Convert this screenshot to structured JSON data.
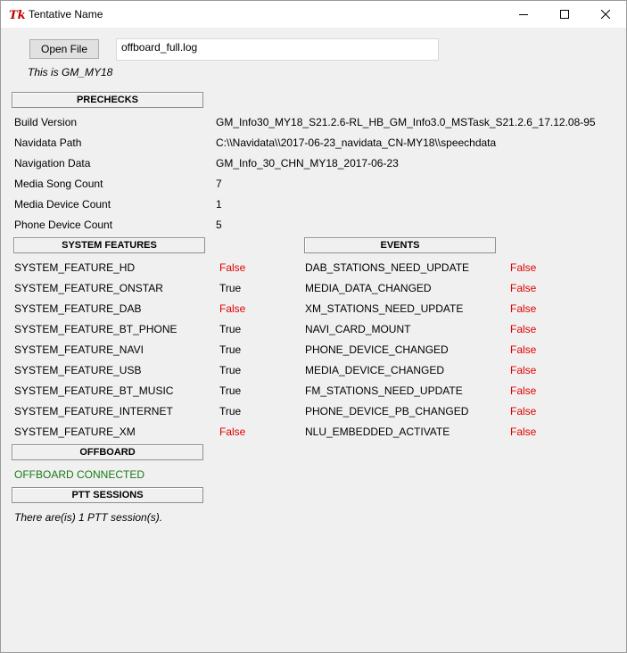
{
  "window": {
    "title": "Tentative Name"
  },
  "file": {
    "open_button": "Open File",
    "path_value": "offboard_full.log",
    "info": "This is GM_MY18"
  },
  "prechecks": {
    "header": "PRECHECKS",
    "rows": [
      {
        "label": "Build Version",
        "value": "GM_Info30_MY18_S21.2.6-RL_HB_GM_Info3.0_MSTask_S21.2.6_17.12.08-95"
      },
      {
        "label": "Navidata Path",
        "value": "C:\\\\Navidata\\\\2017-06-23_navidata_CN-MY18\\\\speechdata"
      },
      {
        "label": "Navigation Data",
        "value": "GM_Info_30_CHN_MY18_2017-06-23"
      },
      {
        "label": "Media Song Count",
        "value": "7"
      },
      {
        "label": "Media Device Count",
        "value": "1"
      },
      {
        "label": "Phone Device Count",
        "value": "5"
      }
    ]
  },
  "system_features": {
    "header": "SYSTEM FEATURES",
    "rows": [
      {
        "label": "SYSTEM_FEATURE_HD",
        "value": "False"
      },
      {
        "label": "SYSTEM_FEATURE_ONSTAR",
        "value": "True"
      },
      {
        "label": "SYSTEM_FEATURE_DAB",
        "value": "False"
      },
      {
        "label": "SYSTEM_FEATURE_BT_PHONE",
        "value": "True"
      },
      {
        "label": "SYSTEM_FEATURE_NAVI",
        "value": "True"
      },
      {
        "label": "SYSTEM_FEATURE_USB",
        "value": "True"
      },
      {
        "label": "SYSTEM_FEATURE_BT_MUSIC",
        "value": "True"
      },
      {
        "label": "SYSTEM_FEATURE_INTERNET",
        "value": "True"
      },
      {
        "label": "SYSTEM_FEATURE_XM",
        "value": "False"
      }
    ]
  },
  "events": {
    "header": "EVENTS",
    "rows": [
      {
        "label": "DAB_STATIONS_NEED_UPDATE",
        "value": "False"
      },
      {
        "label": "MEDIA_DATA_CHANGED",
        "value": "False"
      },
      {
        "label": "XM_STATIONS_NEED_UPDATE",
        "value": "False"
      },
      {
        "label": "NAVI_CARD_MOUNT",
        "value": "False"
      },
      {
        "label": "PHONE_DEVICE_CHANGED",
        "value": "False"
      },
      {
        "label": "MEDIA_DEVICE_CHANGED",
        "value": "False"
      },
      {
        "label": "FM_STATIONS_NEED_UPDATE",
        "value": "False"
      },
      {
        "label": "PHONE_DEVICE_PB_CHANGED",
        "value": "False"
      },
      {
        "label": "NLU_EMBEDDED_ACTIVATE",
        "value": "False"
      }
    ]
  },
  "offboard": {
    "header": "OFFBOARD",
    "status": "OFFBOARD CONNECTED"
  },
  "ptt": {
    "header": "PTT SESSIONS",
    "status": "There are(is) 1 PTT session(s)."
  },
  "colors": {
    "false": "#e00000",
    "true": "#000000",
    "connected": "#1a7a1a"
  }
}
